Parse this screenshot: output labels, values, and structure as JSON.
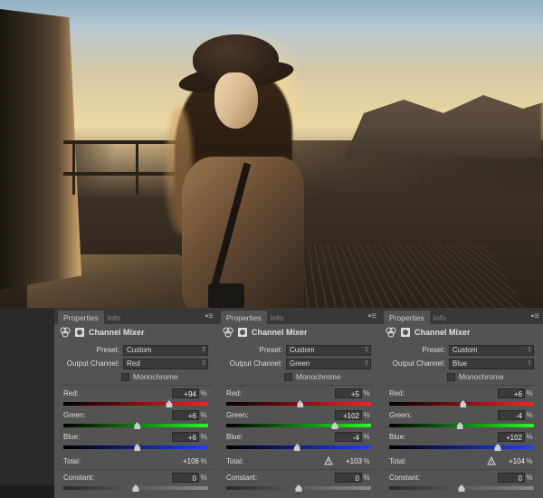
{
  "tabs": {
    "properties": "Properties",
    "info": "Info"
  },
  "panel_title": "Channel Mixer",
  "labels": {
    "preset": "Preset:",
    "output_channel": "Output Channel:",
    "monochrome": "Monochrome",
    "red": "Red:",
    "green": "Green:",
    "blue": "Blue:",
    "total": "Total:",
    "constant": "Constant:",
    "unit": "%"
  },
  "panels": [
    {
      "preset": "Custom",
      "output_channel": "Red",
      "monochrome": false,
      "sliders": {
        "red": "+94",
        "green": "+6",
        "blue": "+6"
      },
      "total": "+106",
      "warn": false,
      "constant": "0"
    },
    {
      "preset": "Custom",
      "output_channel": "Green",
      "monochrome": false,
      "sliders": {
        "red": "+5",
        "green": "+102",
        "blue": "-4"
      },
      "total": "+103",
      "warn": true,
      "constant": "0"
    },
    {
      "preset": "Custom",
      "output_channel": "Blue",
      "monochrome": false,
      "sliders": {
        "red": "+6",
        "green": "-4",
        "blue": "+102"
      },
      "total": "+104",
      "warn": true,
      "constant": "0"
    }
  ]
}
